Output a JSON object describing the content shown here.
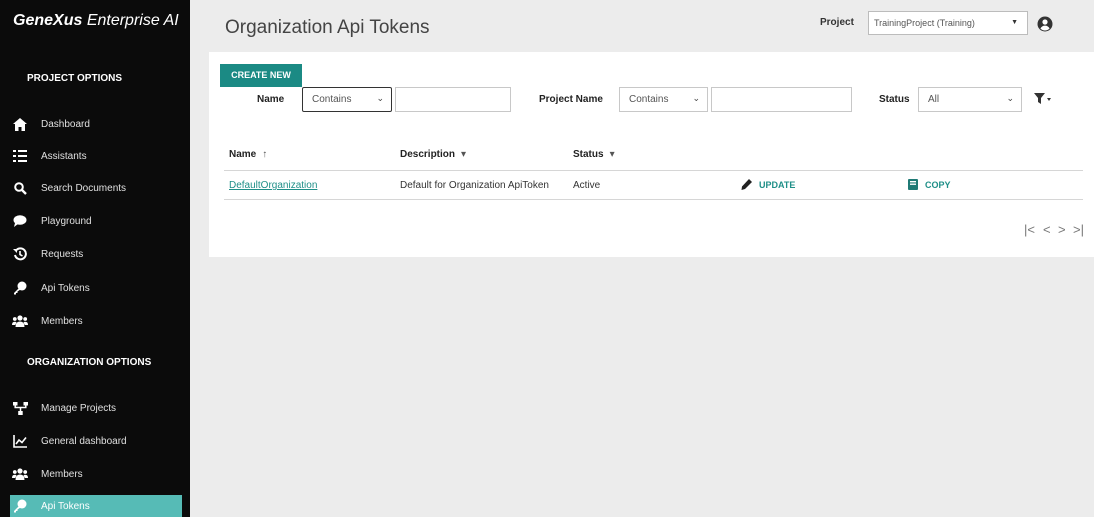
{
  "brand": {
    "name_bold": "GeneXus",
    "name_rest": "Enterprise AI"
  },
  "sidebar": {
    "project_section": "PROJECT OPTIONS",
    "project_items": [
      {
        "label": "Dashboard",
        "icon": "home-icon"
      },
      {
        "label": "Assistants",
        "icon": "list-icon"
      },
      {
        "label": "Search Documents",
        "icon": "search-icon"
      },
      {
        "label": "Playground",
        "icon": "chat-icon"
      },
      {
        "label": "Requests",
        "icon": "history-icon"
      },
      {
        "label": "Api Tokens",
        "icon": "key-icon"
      },
      {
        "label": "Members",
        "icon": "users-icon"
      }
    ],
    "org_section": "ORGANIZATION OPTIONS",
    "org_items": [
      {
        "label": "Manage Projects",
        "icon": "sitemap-icon"
      },
      {
        "label": "General dashboard",
        "icon": "chart-icon"
      },
      {
        "label": "Members",
        "icon": "users-icon"
      },
      {
        "label": "Api Tokens",
        "icon": "key-icon",
        "active": true
      }
    ],
    "active_color": "#56bbb6"
  },
  "header": {
    "title": "Organization Api Tokens",
    "project_label": "Project",
    "project_value": "TrainingProject (Training)"
  },
  "toolbar": {
    "create_label": "CREATE NEW",
    "accent": "#1b8a84"
  },
  "filters": {
    "name_label": "Name",
    "name_op": "Contains",
    "name_value": "",
    "project_name_label": "Project Name",
    "project_name_op": "Contains",
    "project_name_value": "",
    "status_label": "Status",
    "status_value": "All"
  },
  "table": {
    "columns": [
      {
        "label": "Name",
        "sort": "↑"
      },
      {
        "label": "Description",
        "sort": "▾"
      },
      {
        "label": "Status",
        "sort": "▾"
      }
    ],
    "rows": [
      {
        "name": "DefaultOrganization",
        "description": "Default for Organization ApiToken",
        "status": "Active",
        "update_label": "UPDATE",
        "copy_label": "COPY"
      }
    ]
  },
  "pager": {
    "first": "|<",
    "prev": "<",
    "next": ">",
    "last": ">|"
  }
}
